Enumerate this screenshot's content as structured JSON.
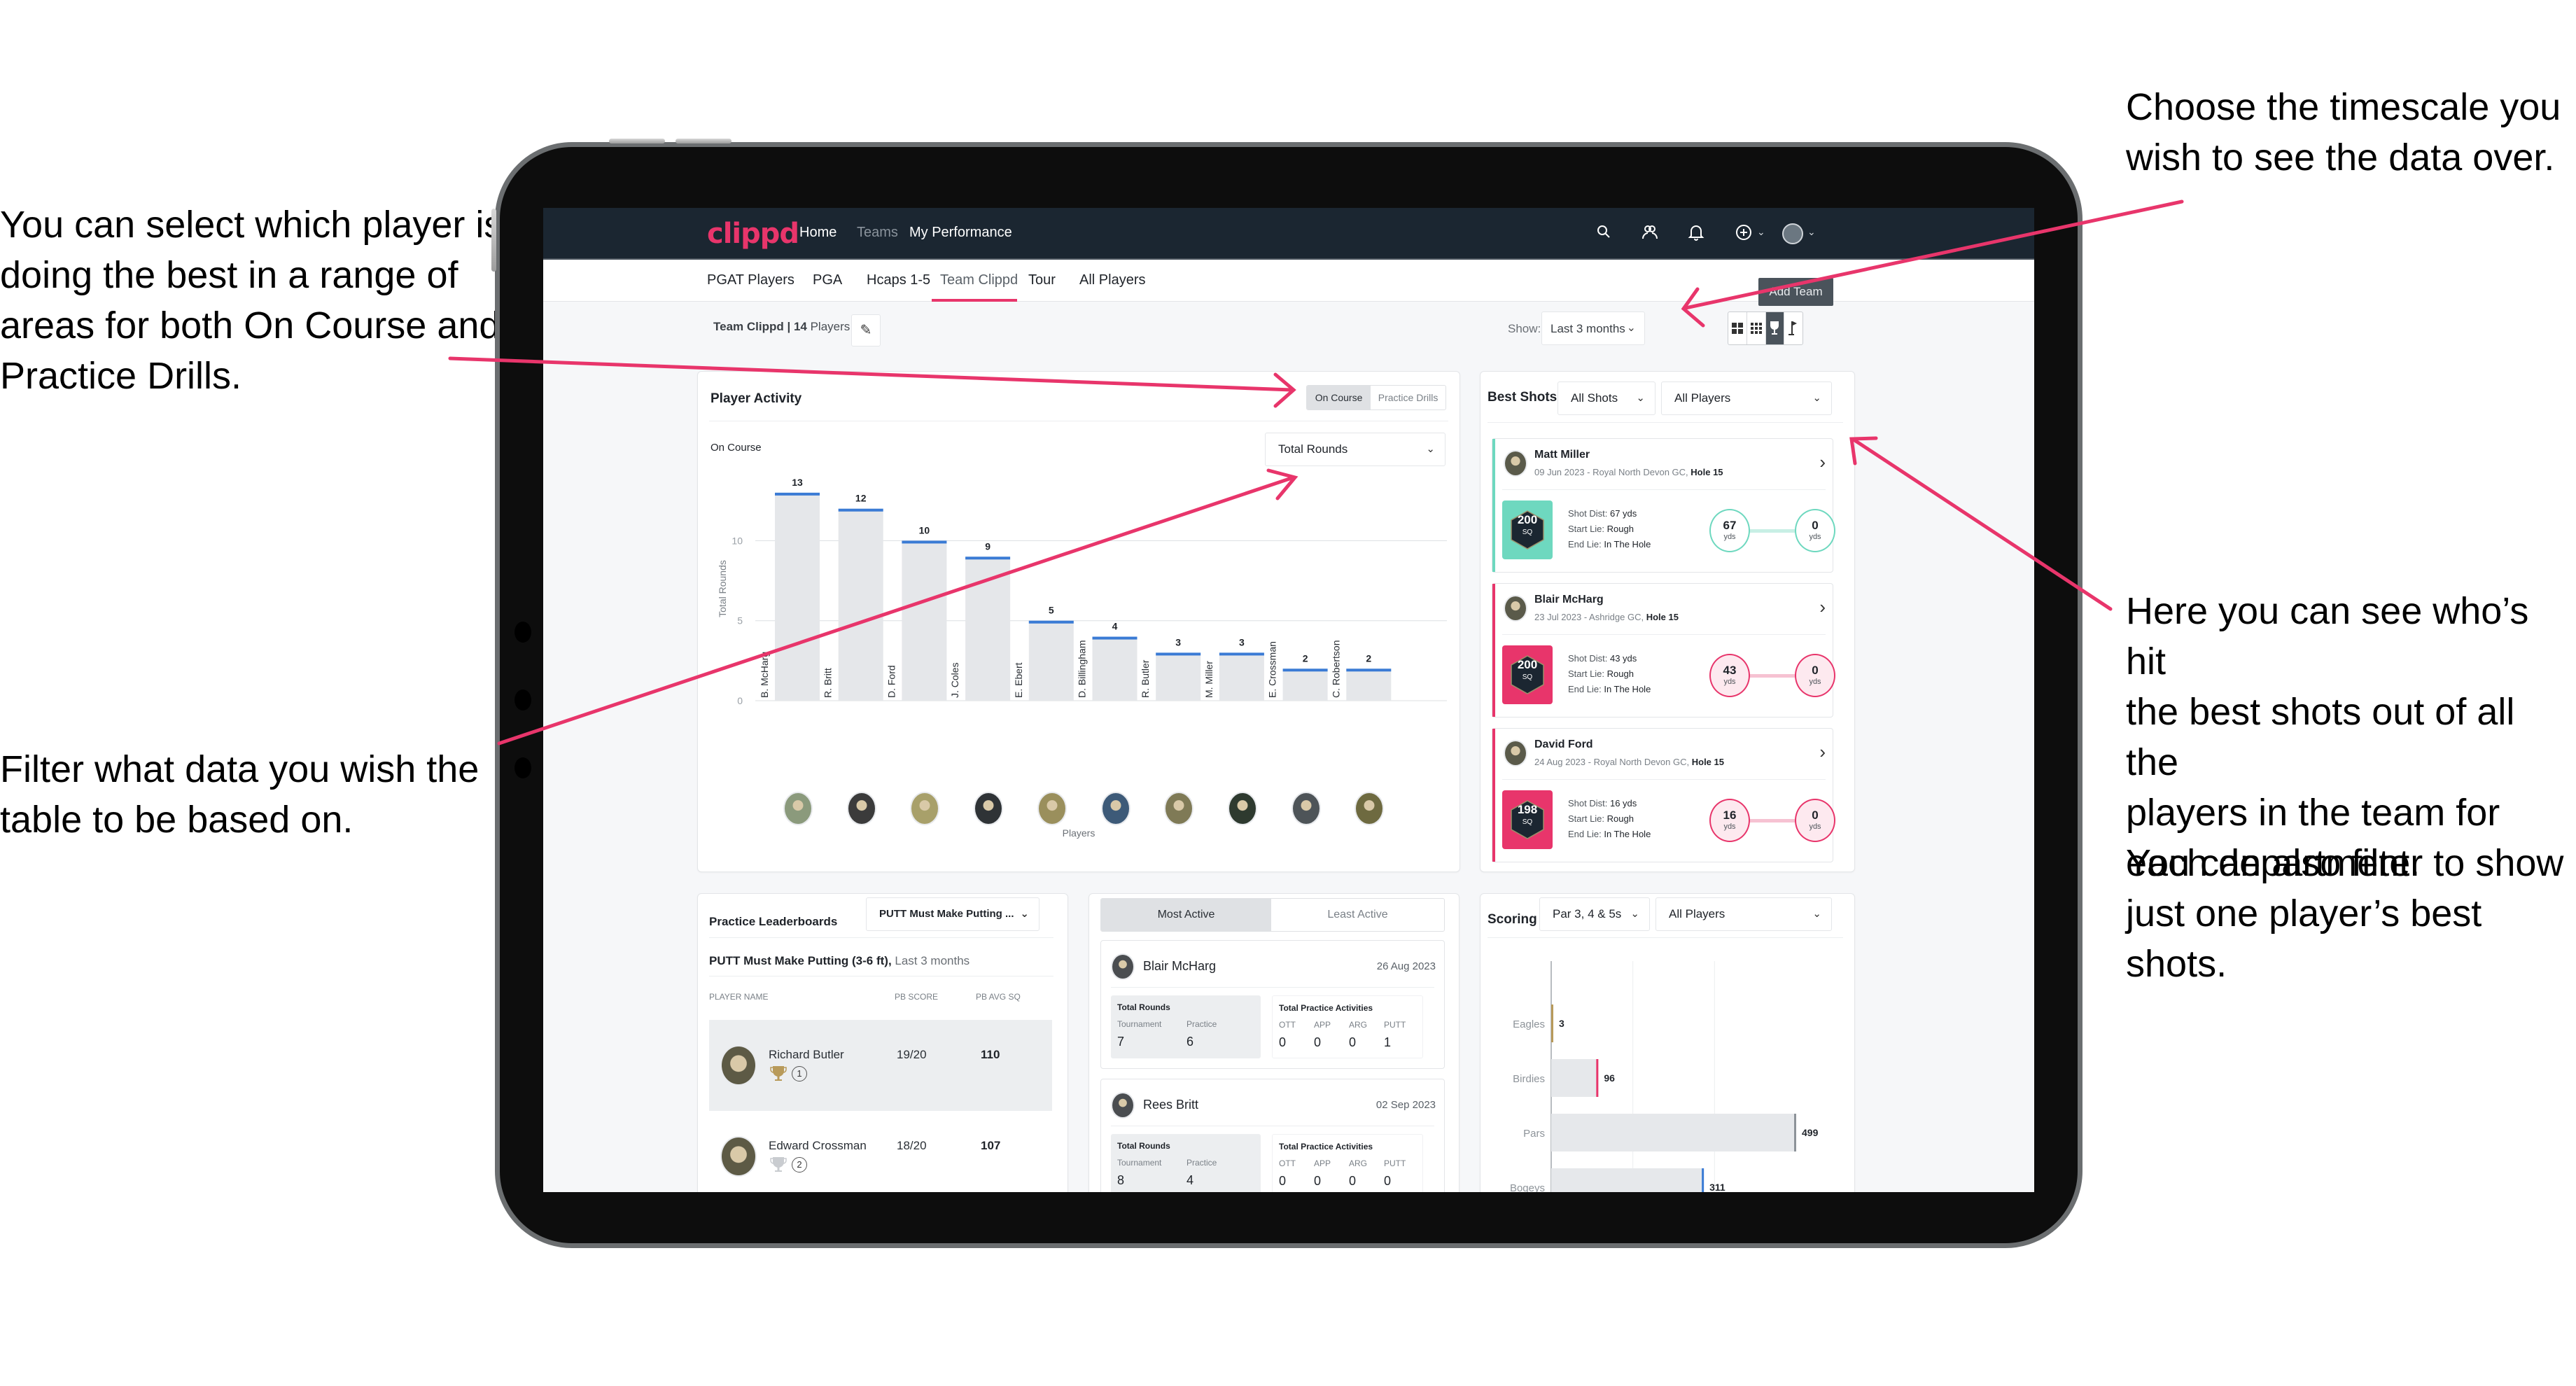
{
  "annotations": {
    "left_top": "You can select which player is\ndoing the best in a range of\nareas for both On Course and\nPractice Drills.",
    "left_bottom": "Filter what data you wish the\ntable to be based on.",
    "right_top": "Choose the timescale you\nwish to see the data over.",
    "right_mid": "Here you can see who’s hit\nthe best shots out of all the\nplayers in the team for\neach department.",
    "right_bottom": "You can also filter to show\njust one player’s best shots."
  },
  "colors": {
    "brand": "#e8356b",
    "nav_bg": "#1b2631",
    "bar_cap": "#3a7bd5",
    "bar_fill": "#e5e7ea",
    "teal": "#6ed8bf",
    "pink": "#e8356b",
    "gold": "#b89a5a"
  },
  "nav": {
    "logo": "clippd",
    "links": [
      "Home",
      "Teams",
      "My Performance"
    ],
    "icons": [
      "search-icon",
      "people-icon",
      "bell-icon",
      "plus-circle-icon",
      "avatar"
    ]
  },
  "subnav": {
    "tabs": [
      "PGAT Players",
      "PGA",
      "Hcaps 1-5",
      "Team Clippd",
      "Tour",
      "All Players"
    ],
    "active_tab": "Team Clippd",
    "add_team": "Add Team"
  },
  "team": {
    "name": "Team Clippd",
    "separator": " | ",
    "count": "14",
    "count_label": " Players"
  },
  "filters": {
    "show_label": "Show:",
    "timescale": "Last 3 months",
    "view_modes": [
      "grid-large-icon",
      "grid-small-icon",
      "trophy-icon",
      "flag-icon"
    ],
    "active_view": "trophy-icon"
  },
  "player_activity": {
    "title": "Player Activity",
    "toggle": [
      "On Course",
      "Practice Drills"
    ],
    "active_toggle": "On Course",
    "subtitle": "On Course",
    "metric": "Total Rounds"
  },
  "chart_data": {
    "type": "bar",
    "title": "On Course",
    "xlabel": "Players",
    "ylabel": "Total Rounds",
    "ylim": [
      0,
      14
    ],
    "yticks": [
      0,
      5,
      10
    ],
    "grid": true,
    "categories": [
      "B. McHarg",
      "R. Britt",
      "D. Ford",
      "J. Coles",
      "E. Ebert",
      "D. Billingham",
      "R. Butler",
      "M. Miller",
      "E. Crossman",
      "C. Robertson"
    ],
    "values": [
      13,
      12,
      10,
      9,
      5,
      4,
      3,
      3,
      2,
      2
    ]
  },
  "best_shots": {
    "title": "Best Shots",
    "shot_filter": "All Shots",
    "player_filter": "All Players",
    "cards": [
      {
        "name": "Matt Miller",
        "meta": "09 Jun 2023 - Royal North Devon GC, ",
        "hole": "Hole 15",
        "sq": "200",
        "sq_label": "SQ",
        "dist_label": "Shot Dist: ",
        "dist": "67 yds",
        "start_label": "Start Lie: ",
        "start": "Rough",
        "end_label": "End Lie: ",
        "end": "In The Hole",
        "from": "67",
        "to": "0",
        "unit": "yds",
        "color": "teal"
      },
      {
        "name": "Blair McHarg",
        "meta": "23 Jul 2023 - Ashridge GC, ",
        "hole": "Hole 15",
        "sq": "200",
        "sq_label": "SQ",
        "dist_label": "Shot Dist: ",
        "dist": "43 yds",
        "start_label": "Start Lie: ",
        "start": "Rough",
        "end_label": "End Lie: ",
        "end": "In The Hole",
        "from": "43",
        "to": "0",
        "unit": "yds",
        "color": "pink"
      },
      {
        "name": "David Ford",
        "meta": "24 Aug 2023 - Royal North Devon GC, ",
        "hole": "Hole 15",
        "sq": "198",
        "sq_label": "SQ",
        "dist_label": "Shot Dist: ",
        "dist": "16 yds",
        "start_label": "Start Lie: ",
        "start": "Rough",
        "end_label": "End Lie: ",
        "end": "In The Hole",
        "from": "16",
        "to": "0",
        "unit": "yds",
        "color": "pink"
      }
    ]
  },
  "leaderboard": {
    "title": "Practice Leaderboards",
    "drill_select": "PUTT Must Make Putting ...",
    "drill_name": "PUTT Must Make Putting (3-6 ft),",
    "period": " Last 3 months",
    "columns": [
      "PLAYER NAME",
      "PB SCORE",
      "PB AVG SQ"
    ],
    "rows": [
      {
        "name": "Richard Butler",
        "score": "19/20",
        "avg": "110",
        "rank": "1"
      },
      {
        "name": "Edward Crossman",
        "score": "18/20",
        "avg": "107",
        "rank": "2"
      }
    ]
  },
  "activity": {
    "tabs": [
      "Most Active",
      "Least Active"
    ],
    "active_tab": "Most Active",
    "rounds_title": "Total Rounds",
    "rounds_cols": [
      "Tournament",
      "Practice"
    ],
    "practice_title": "Total Practice Activities",
    "practice_cols": [
      "OTT",
      "APP",
      "ARG",
      "PUTT"
    ],
    "players": [
      {
        "name": "Blair McHarg",
        "date": "26 Aug 2023",
        "tournament": "7",
        "practice": "6",
        "ott": "0",
        "app": "0",
        "arg": "0",
        "putt": "1"
      },
      {
        "name": "Rees Britt",
        "date": "02 Sep 2023",
        "tournament": "8",
        "practice": "4",
        "ott": "0",
        "app": "0",
        "arg": "0",
        "putt": "0"
      }
    ]
  },
  "scoring": {
    "title": "Scoring",
    "hole_filter": "Par 3, 4 & 5s",
    "player_filter": "All Players",
    "categories": [
      "Eagles",
      "Birdies",
      "Pars",
      "Bogeys"
    ],
    "values": [
      3,
      96,
      499,
      311
    ],
    "max": 600
  }
}
